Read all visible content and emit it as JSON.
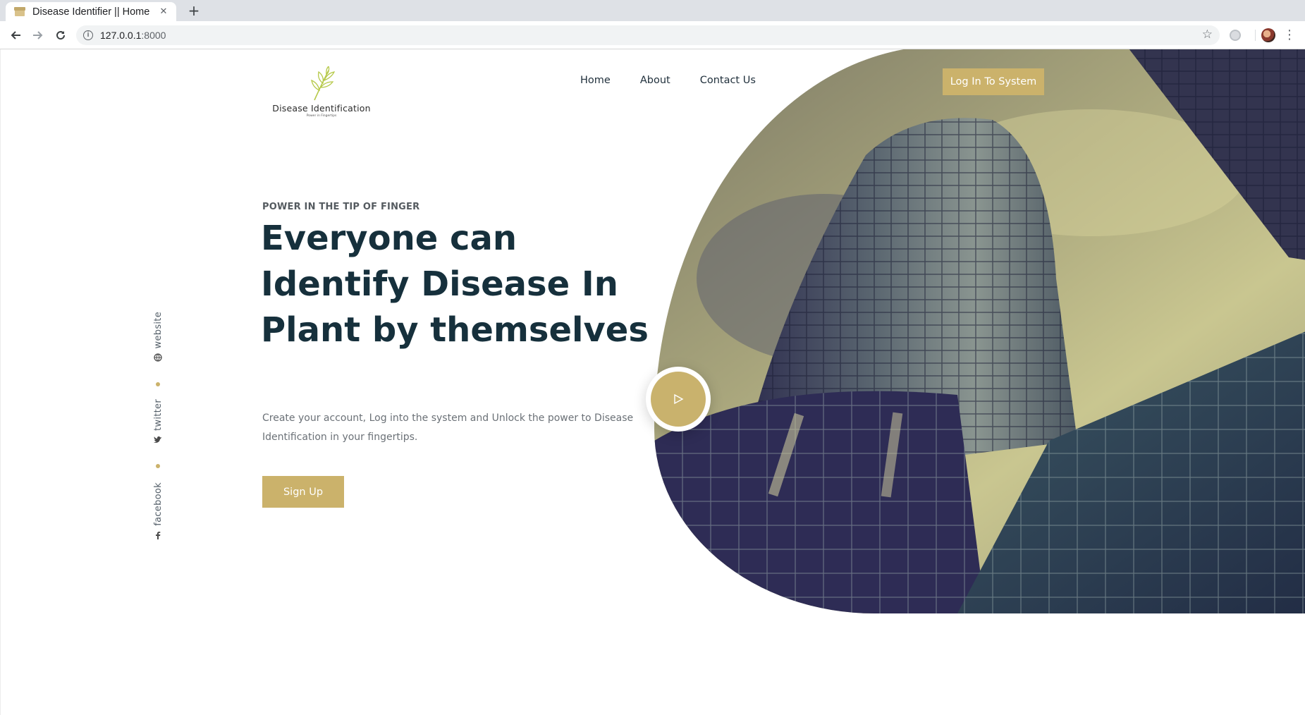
{
  "browser": {
    "tab_title": "Disease Identifier || Home",
    "close_symbol": "✕",
    "new_tab_symbol": "+",
    "url_host": "127.0.0.1",
    "url_port": ":8000"
  },
  "colors": {
    "accent": "#cbb26b",
    "heading": "#16303c",
    "body_text": "#6b7177"
  },
  "logo": {
    "name": "Disease Identification",
    "tagline": "Power in Fingertips"
  },
  "nav": {
    "home": "Home",
    "about": "About",
    "contact": "Contact Us",
    "login": "Log In To System"
  },
  "social": {
    "website": "website",
    "twitter": "twitter",
    "facebook": "facebook"
  },
  "hero": {
    "eyebrow": "POWER IN THE TIP OF FINGER",
    "headline_line1": "Everyone can",
    "headline_line2": "Identify Disease In",
    "headline_line3": "Plant by themselves",
    "description": "Create your account, Log into the system and Unlock the power to Disease Identification in your fingertips.",
    "signup": "Sign Up",
    "play_icon": "play-icon",
    "image_subject": "glass skyscraper"
  }
}
